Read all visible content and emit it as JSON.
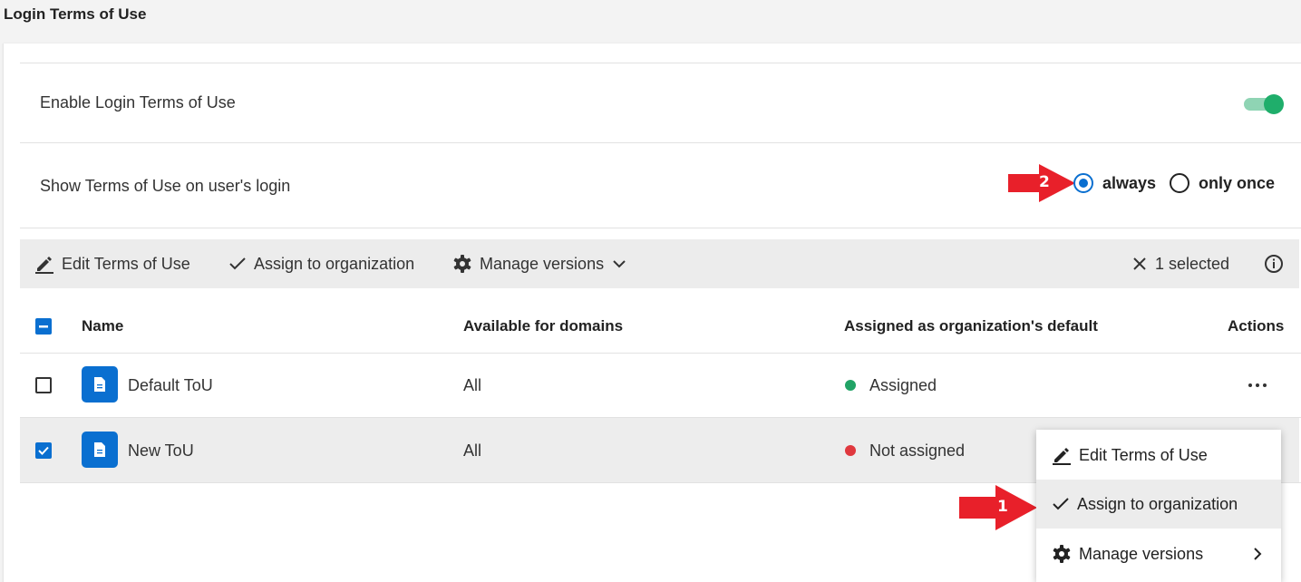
{
  "page": {
    "title": "Login Terms of Use"
  },
  "settings": {
    "enable_label": "Enable Login Terms of Use",
    "enable_state": "on",
    "show_label": "Show Terms of Use on user's login",
    "radio_always": "always",
    "radio_once": "only once",
    "selected_option": "always"
  },
  "toolbar": {
    "edit": "Edit Terms of Use",
    "assign": "Assign to organization",
    "manage": "Manage versions",
    "selected": "1 selected"
  },
  "table": {
    "headers": {
      "name": "Name",
      "domains": "Available for domains",
      "assigned": "Assigned as organization's default",
      "actions": "Actions"
    },
    "rows": [
      {
        "name": "Default ToU",
        "domains": "All",
        "status": "Assigned",
        "status_color": "#21a366",
        "checked": false
      },
      {
        "name": "New ToU",
        "domains": "All",
        "status": "Not assigned",
        "status_color": "#e0383e",
        "checked": true
      }
    ]
  },
  "menu": {
    "edit": "Edit Terms of Use",
    "assign": "Assign to organization",
    "manage": "Manage versions"
  },
  "annotations": {
    "step1": "1",
    "step2": "2",
    "color": "#e8202a"
  },
  "colors": {
    "accent": "#0a6fd0",
    "toggle": "#1fae6b"
  }
}
